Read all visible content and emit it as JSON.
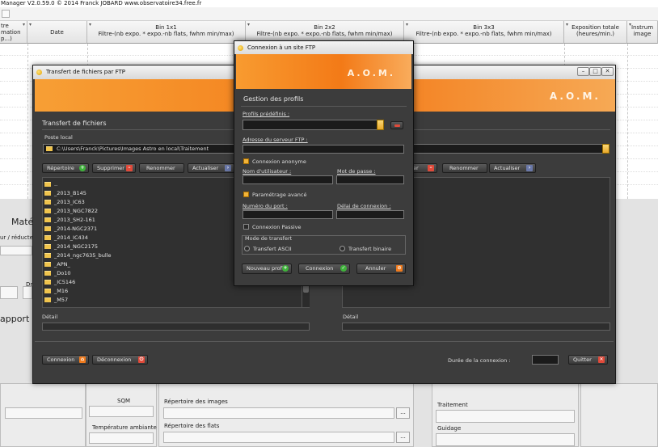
{
  "bg_app": {
    "title": "Manager V2.0.59.0 © 2014 Franck JOBARD www.observatoire34.free.fr",
    "columns": [
      {
        "label": "tre\nmation\np...)"
      },
      {
        "label": "Date"
      },
      {
        "label": "Bin 1x1\nFiltre-(nb expo. * expo.-nb flats, fwhm min/max)"
      },
      {
        "label": "Bin 2x2\nFiltre-(nb expo. * expo.-nb flats, fwhm min/max)"
      },
      {
        "label": "Bin 3x3\nFiltre-(nb expo. * expo.-nb flats, fwhm min/max)"
      },
      {
        "label": "Exposition totale\n(heures/min.)"
      },
      {
        "label": "Instrum\nimage"
      }
    ],
    "left_labels": {
      "materiel": "Maté",
      "reducteur": "ur / réducte",
      "dr": "Dr",
      "rapport": "apport d"
    },
    "sqm_label": "SQM",
    "temperature_label": "Température ambiante",
    "repertoire_images_label": "Répertoire des images",
    "repertoire_flats_label": "Répertoire des flats",
    "traitement_label": "Traitement",
    "guidage_label": "Guidage",
    "browse_label": "..."
  },
  "ftp_window": {
    "title": "Transfert de fichiers par FTP",
    "banner_text": "A.O.M.",
    "section_title": "Transfert de fichiers",
    "local_label": "Poste local",
    "local_path": "C:\\Users\\Franck\\Pictures\\Images Astro en local\\Traitement",
    "buttons_left": {
      "repertoire": "Répertoire",
      "supprimer": "Supprimer",
      "renommer": "Renommer",
      "actualiser": "Actualiser"
    },
    "buttons_right": {
      "supprimer_partial": "er",
      "renommer": "Renommer",
      "actualiser": "Actualiser"
    },
    "folders": [
      "..",
      "_2013_B145",
      "_2013_IC63",
      "_2013_NGC7822",
      "_2013_SH2-161",
      "_2014-NGC2371",
      "_2014_IC434",
      "_2014_NGC2175",
      "_2014_ngc7635_bulle",
      "_APN_",
      "_Do10",
      "_IC5146",
      "_M16",
      "_M57"
    ],
    "detail_label_left": "Détail",
    "detail_label_right": "Détail",
    "connexion_button": "Connexion",
    "deconnexion_button": "Déconnexion",
    "duree_label": "Durée de la connexion :",
    "quitter_button": "Quitter",
    "window_controls": {
      "minimize": "–",
      "maximize": "□",
      "close": "✕"
    }
  },
  "connect_dialog": {
    "title": "Connexion à un site FTP",
    "banner_text": "A.O.M.",
    "section_title": "Gestion des profils",
    "profils_label": "Profils prédéfinis :",
    "profils_value": "",
    "adresse_label": "Adresse du serveur FTP :",
    "adresse_value": "",
    "anonyme_label": "Connexion anonyme",
    "anonyme_checked": true,
    "user_label": "Nom d'utilisateur :",
    "user_value": "",
    "password_label": "Mot de passe :",
    "password_value": "",
    "avance_label": "Paramétrage avancé",
    "avance_checked": true,
    "port_label": "Numéro du port :",
    "port_value": "",
    "delai_label": "Délai de connexion :",
    "delai_value": "",
    "passive_label": "Connexion Passive",
    "passive_checked": false,
    "mode_label": "Mode de transfert",
    "mode_ascii": "Transfert ASCII",
    "mode_binaire": "Transfert binaire",
    "mode_selected": "none",
    "nouveau_profil_button": "Nouveau profil",
    "connexion_button": "Connexion",
    "annuler_button": "Annuler"
  },
  "icons": {
    "app": "sun-icon",
    "add": "plus-circle-icon",
    "delete": "minus-icon",
    "connect": "house-icon",
    "disconnect": "power-icon",
    "quit": "close-icon",
    "ok": "check-icon",
    "cancel": "cancel-icon",
    "folder": "folder-icon"
  },
  "colors": {
    "accent_orange": "#f37b19",
    "dark_panel": "#3c3c3c",
    "checkbox_yellow": "#f2b43a"
  }
}
